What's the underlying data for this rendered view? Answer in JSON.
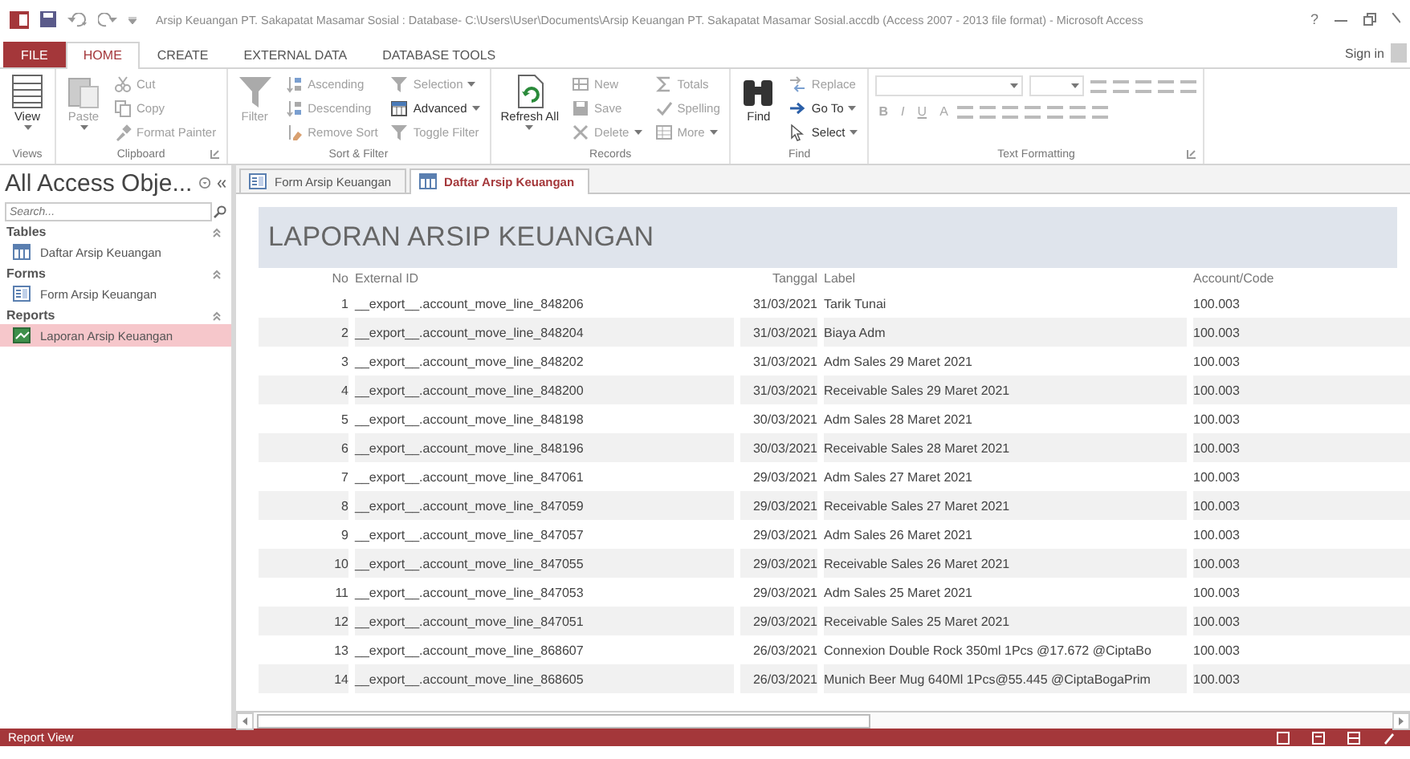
{
  "window": {
    "title": "Arsip Keuangan PT. Sakapatat Masamar Sosial : Database- C:\\Users\\User\\Documents\\Arsip Keuangan PT. Sakapatat Masamar Sosial.accdb (Access 2007 - 2013 file format) - Microsoft Access",
    "help": "?",
    "sign_in": "Sign in"
  },
  "ribbon_tabs": [
    {
      "label": "FILE",
      "kind": "file",
      "selected": false
    },
    {
      "label": "HOME",
      "kind": "tab",
      "selected": true
    },
    {
      "label": "CREATE",
      "kind": "tab",
      "selected": false
    },
    {
      "label": "EXTERNAL DATA",
      "kind": "tab",
      "selected": false
    },
    {
      "label": "DATABASE TOOLS",
      "kind": "tab",
      "selected": false
    }
  ],
  "ribbon_groups": [
    {
      "label": "Views",
      "launcher": false,
      "columns": [
        [
          {
            "kind": "large",
            "label": "View",
            "dropdown": true,
            "disabled": false
          }
        ]
      ]
    },
    {
      "label": "Clipboard",
      "launcher": true,
      "columns": [
        [
          {
            "kind": "large",
            "label": "Paste",
            "dropdown": true,
            "disabled": true
          }
        ],
        [
          {
            "kind": "small",
            "label": "Cut",
            "dropdown": false,
            "disabled": true
          },
          {
            "kind": "small",
            "label": "Copy",
            "dropdown": false,
            "disabled": true
          },
          {
            "kind": "small",
            "label": "Format Painter",
            "dropdown": false,
            "disabled": true
          }
        ]
      ]
    },
    {
      "label": "Sort & Filter",
      "launcher": false,
      "columns": [
        [
          {
            "kind": "large",
            "label": "Filter",
            "dropdown": false,
            "disabled": true
          }
        ],
        [
          {
            "kind": "small",
            "label": "Ascending",
            "dropdown": false,
            "disabled": true
          },
          {
            "kind": "small",
            "label": "Descending",
            "dropdown": false,
            "disabled": true
          },
          {
            "kind": "small",
            "label": "Remove Sort",
            "dropdown": false,
            "disabled": true
          }
        ],
        [
          {
            "kind": "small",
            "label": "Selection",
            "dropdown": true,
            "disabled": true
          },
          {
            "kind": "small",
            "label": "Advanced",
            "dropdown": true,
            "disabled": false
          },
          {
            "kind": "small",
            "label": "Toggle Filter",
            "dropdown": false,
            "disabled": true
          }
        ]
      ]
    },
    {
      "label": "Records",
      "launcher": false,
      "columns": [
        [
          {
            "kind": "large",
            "label": "Refresh All",
            "dropdown": true,
            "disabled": false
          }
        ],
        [
          {
            "kind": "small",
            "label": "New",
            "dropdown": false,
            "disabled": true
          },
          {
            "kind": "small",
            "label": "Save",
            "dropdown": false,
            "disabled": true
          },
          {
            "kind": "small",
            "label": "Delete",
            "dropdown": true,
            "disabled": true
          }
        ],
        [
          {
            "kind": "small",
            "label": "Totals",
            "dropdown": false,
            "disabled": true
          },
          {
            "kind": "small",
            "label": "Spelling",
            "dropdown": false,
            "disabled": true
          },
          {
            "kind": "small",
            "label": "More",
            "dropdown": true,
            "disabled": true
          }
        ]
      ]
    },
    {
      "label": "Find",
      "launcher": false,
      "columns": [
        [
          {
            "kind": "large",
            "label": "Find",
            "dropdown": false,
            "disabled": false
          }
        ],
        [
          {
            "kind": "small",
            "label": "Replace",
            "dropdown": false,
            "disabled": true
          },
          {
            "kind": "small",
            "label": "Go To",
            "dropdown": true,
            "disabled": false
          },
          {
            "kind": "small",
            "label": "Select",
            "dropdown": true,
            "disabled": false
          }
        ]
      ]
    },
    {
      "label": "Text Formatting",
      "launcher": true,
      "columns": [
        [
          {
            "kind": "formatting",
            "disabled": true
          }
        ]
      ],
      "format_buttons": [
        "B",
        "I",
        "U",
        "A"
      ]
    }
  ],
  "nav_pane": {
    "title": "All Access Obje...",
    "search": {
      "placeholder": "Search..."
    },
    "groups": [
      {
        "label": "Tables",
        "items": [
          {
            "label": "Daftar Arsip Keuangan",
            "kind": "table",
            "selected": false
          }
        ]
      },
      {
        "label": "Forms",
        "items": [
          {
            "label": "Form Arsip Keuangan",
            "kind": "form",
            "selected": false
          }
        ]
      },
      {
        "label": "Reports",
        "items": [
          {
            "label": "Laporan Arsip Keuangan",
            "kind": "report",
            "selected": true
          }
        ]
      }
    ]
  },
  "document_tabs": [
    {
      "label": "Form Arsip Keuangan",
      "kind": "form",
      "selected": false
    },
    {
      "label": "Daftar Arsip Keuangan",
      "kind": "table",
      "selected": true
    }
  ],
  "report": {
    "title": "LAPORAN ARSIP KEUANGAN",
    "columns": [
      "No",
      "External ID",
      "Tanggal",
      "Label",
      "Account/Code"
    ],
    "rows": [
      [
        "1",
        "__export__.account_move_line_848206",
        "31/03/2021",
        "Tarik Tunai",
        "100.003"
      ],
      [
        "2",
        "__export__.account_move_line_848204",
        "31/03/2021",
        "Biaya Adm",
        "100.003"
      ],
      [
        "3",
        "__export__.account_move_line_848202",
        "31/03/2021",
        "Adm Sales 29 Maret 2021",
        "100.003"
      ],
      [
        "4",
        "__export__.account_move_line_848200",
        "31/03/2021",
        "Receivable Sales 29 Maret 2021",
        "100.003"
      ],
      [
        "5",
        "__export__.account_move_line_848198",
        "30/03/2021",
        "Adm Sales 28 Maret 2021",
        "100.003"
      ],
      [
        "6",
        "__export__.account_move_line_848196",
        "30/03/2021",
        "Receivable Sales 28 Maret 2021",
        "100.003"
      ],
      [
        "7",
        "__export__.account_move_line_847061",
        "29/03/2021",
        "Adm Sales 27 Maret 2021",
        "100.003"
      ],
      [
        "8",
        "__export__.account_move_line_847059",
        "29/03/2021",
        "Receivable Sales 27 Maret 2021",
        "100.003"
      ],
      [
        "9",
        "__export__.account_move_line_847057",
        "29/03/2021",
        "Adm Sales 26 Maret 2021",
        "100.003"
      ],
      [
        "10",
        "__export__.account_move_line_847055",
        "29/03/2021",
        "Receivable Sales 26 Maret 2021",
        "100.003"
      ],
      [
        "11",
        "__export__.account_move_line_847053",
        "29/03/2021",
        "Adm Sales 25 Maret 2021",
        "100.003"
      ],
      [
        "12",
        "__export__.account_move_line_847051",
        "29/03/2021",
        "Receivable Sales 25 Maret 2021",
        "100.003"
      ],
      [
        "13",
        "__export__.account_move_line_868607",
        "26/03/2021",
        "Connexion Double Rock 350ml 1Pcs @17.672 @CiptaBo",
        "100.003"
      ],
      [
        "14",
        "__export__.account_move_line_868605",
        "26/03/2021",
        "Munich Beer Mug 640Ml 1Pcs@55.445 @CiptaBogaPrim",
        "100.003"
      ]
    ]
  },
  "status_bar": {
    "text": "Report View"
  }
}
